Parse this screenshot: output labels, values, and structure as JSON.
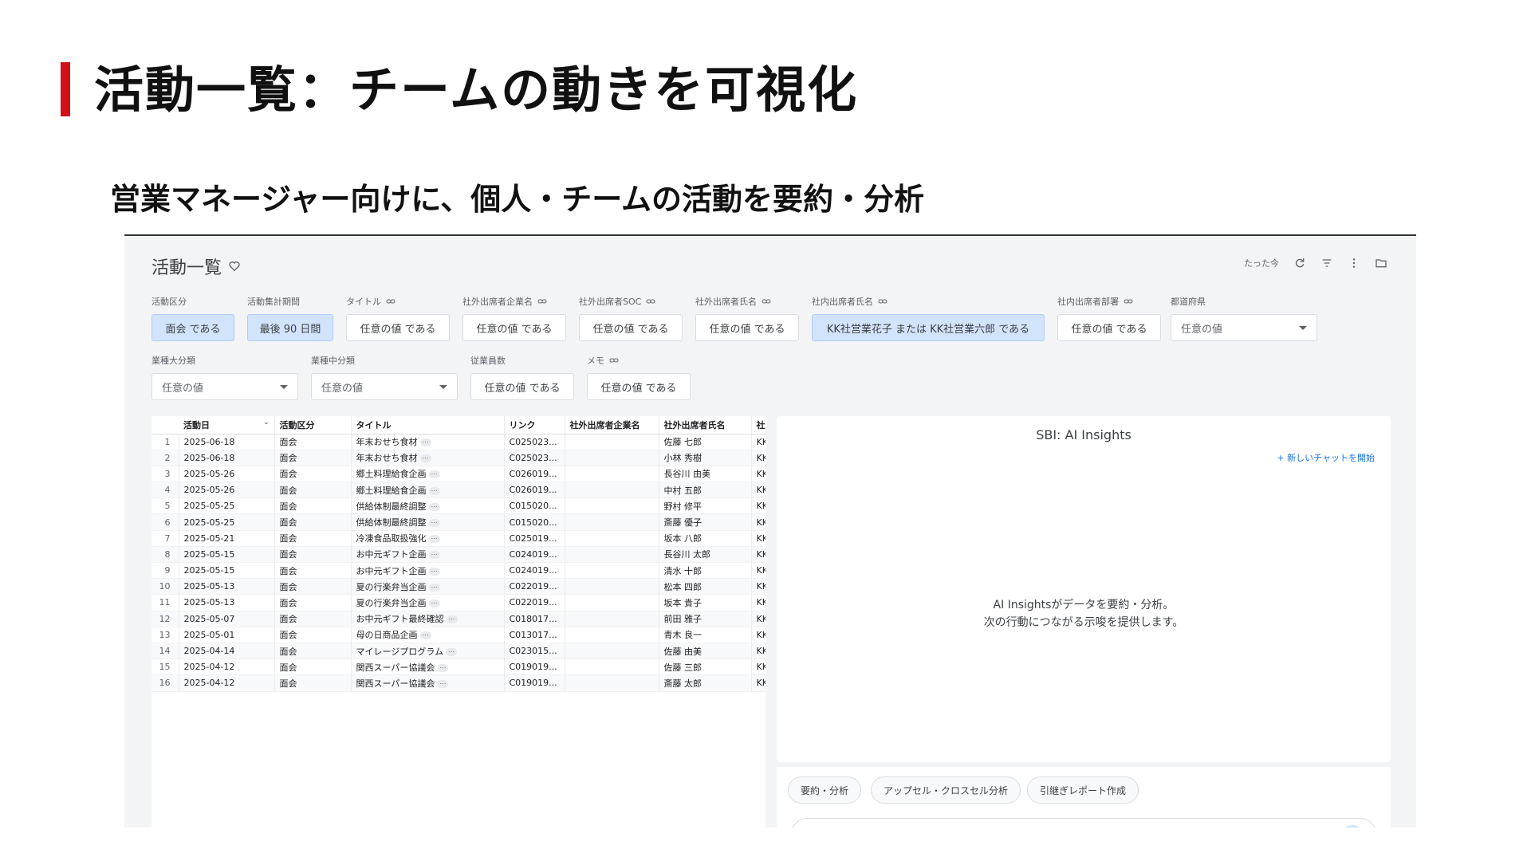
{
  "slide": {
    "title": "活動一覧：チームの動きを可視化",
    "subtitle": "営業マネージャー向けに、個人・チームの活動を要約・分析"
  },
  "app": {
    "title": "活動一覧",
    "updated": "たった今"
  },
  "filters": {
    "activity_type": {
      "label": "活動区分",
      "value": "面会 である"
    },
    "period": {
      "label": "活動集計期間",
      "value": "最後 90 日間"
    },
    "title": {
      "label": "タイトル",
      "value": "任意の値 である"
    },
    "ext_company": {
      "label": "社外出席者企業名",
      "value": "任意の値 である"
    },
    "ext_soc": {
      "label": "社外出席者SOC",
      "value": "任意の値 である"
    },
    "ext_name": {
      "label": "社外出席者氏名",
      "value": "任意の値 である"
    },
    "int_name": {
      "label": "社内出席者氏名",
      "value": "KK社営業花子 または KK社営業六郎 である"
    },
    "int_dept": {
      "label": "社内出席者部署",
      "value": "任意の値 である"
    },
    "prefecture": {
      "label": "都道府県",
      "value": "任意の値"
    },
    "industry_major": {
      "label": "業種大分類",
      "value": "任意の値"
    },
    "industry_mid": {
      "label": "業種中分類",
      "value": "任意の値"
    },
    "employees": {
      "label": "従業員数",
      "value": "任意の値 である"
    },
    "memo": {
      "label": "メモ",
      "value": "任意の値 である"
    }
  },
  "table": {
    "columns": [
      "活動日",
      "活動区分",
      "タイトル",
      "リンク",
      "社外出席者企業名",
      "社外出席者氏名",
      "社内"
    ],
    "rows": [
      [
        "1",
        "2025-06-18",
        "面会",
        "年末おせち食材",
        "C025023...",
        "",
        "佐藤 七郎",
        "KK"
      ],
      [
        "2",
        "2025-06-18",
        "面会",
        "年末おせち食材",
        "C025023...",
        "",
        "小林 秀樹",
        "KK"
      ],
      [
        "3",
        "2025-05-26",
        "面会",
        "郷土料理給食企画",
        "C026019...",
        "",
        "長谷川 由美",
        "KK"
      ],
      [
        "4",
        "2025-05-26",
        "面会",
        "郷土料理給食企画",
        "C026019...",
        "",
        "中村 五郎",
        "KK"
      ],
      [
        "5",
        "2025-05-25",
        "面会",
        "供給体制最終調整",
        "C015020...",
        "",
        "野村 修平",
        "KK"
      ],
      [
        "6",
        "2025-05-25",
        "面会",
        "供給体制最終調整",
        "C015020...",
        "",
        "斎藤 優子",
        "KK"
      ],
      [
        "7",
        "2025-05-21",
        "面会",
        "冷凍食品取扱強化",
        "C025019...",
        "",
        "坂本 八郎",
        "KK"
      ],
      [
        "8",
        "2025-05-15",
        "面会",
        "お中元ギフト企画",
        "C024019...",
        "",
        "長谷川 太郎",
        "KK"
      ],
      [
        "9",
        "2025-05-15",
        "面会",
        "お中元ギフト企画",
        "C024019...",
        "",
        "清水 十郎",
        "KK"
      ],
      [
        "10",
        "2025-05-13",
        "面会",
        "夏の行楽弁当企画",
        "C022019...",
        "",
        "松本 四郎",
        "KK"
      ],
      [
        "11",
        "2025-05-13",
        "面会",
        "夏の行楽弁当企画",
        "C022019...",
        "",
        "坂本 貴子",
        "KK"
      ],
      [
        "12",
        "2025-05-07",
        "面会",
        "お中元ギフト最終確認",
        "C018017...",
        "",
        "前田 雅子",
        "KK"
      ],
      [
        "13",
        "2025-05-01",
        "面会",
        "母の日商品企画",
        "C013017...",
        "",
        "青木 良一",
        "KK"
      ],
      [
        "14",
        "2025-04-14",
        "面会",
        "マイレージプログラム",
        "C023015...",
        "",
        "佐藤 由美",
        "KK"
      ],
      [
        "15",
        "2025-04-12",
        "面会",
        "関西スーパー協議会",
        "C019019...",
        "",
        "佐藤 三郎",
        "KK"
      ],
      [
        "16",
        "2025-04-12",
        "面会",
        "関西スーパー協議会",
        "C019019...",
        "",
        "斎藤 太郎",
        "KK"
      ]
    ]
  },
  "ai": {
    "title": "SBI: AI Insights",
    "new_chat": "+ 新しいチャットを開始",
    "message_line1": "AI Insightsがデータを要約・分析。",
    "message_line2": "次の行動につながる示唆を提供します。",
    "prompts": [
      "要約・分析",
      "アップセル・クロスセル分析",
      "引継ぎレポート作成"
    ]
  },
  "colors": {
    "accent": "#d0121b",
    "chip_active": "#d2e3fc",
    "link": "#1a73e8"
  }
}
